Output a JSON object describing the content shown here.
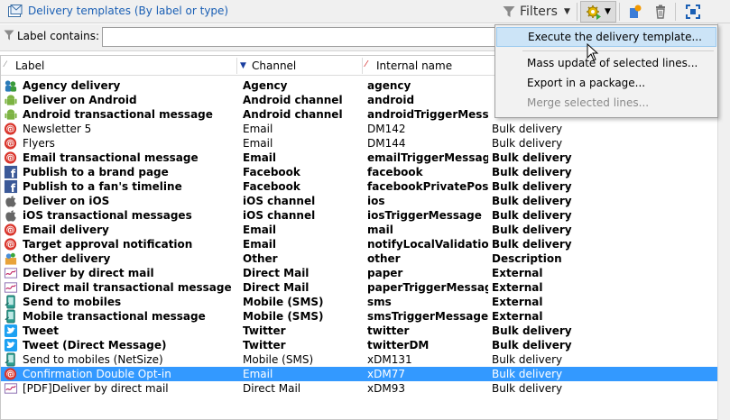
{
  "toolbar": {
    "title": "Delivery templates (By label or type)",
    "filters_label": "Filters"
  },
  "filter": {
    "label": "Label contains:",
    "value": ""
  },
  "columns": {
    "label": "Label",
    "channel": "Channel",
    "internal": "Internal name"
  },
  "menu": {
    "items": [
      {
        "label": "Execute the delivery template...",
        "state": "hover"
      },
      {
        "label": "Mass update of selected lines...",
        "state": "normal"
      },
      {
        "label": "Export in a package...",
        "state": "normal"
      },
      {
        "label": "Merge selected lines...",
        "state": "disabled"
      }
    ]
  },
  "colors": {
    "accent": "#1a5fb4",
    "selection": "#3399ff",
    "menu_hover": "#cce4f7"
  },
  "rows": [
    {
      "icon": "agency-icon",
      "label": "Agency delivery",
      "channel": "Agency",
      "internal": "agency",
      "type": "",
      "bold": true
    },
    {
      "icon": "android-icon",
      "label": "Deliver on Android",
      "channel": "Android channel",
      "internal": "android",
      "type": "",
      "bold": true
    },
    {
      "icon": "android-icon",
      "label": "Android transactional message",
      "channel": "Android channel",
      "internal": "androidTriggerMessage",
      "type": "",
      "bold": true
    },
    {
      "icon": "email-icon",
      "label": "Newsletter 5",
      "channel": "Email",
      "internal": "DM142",
      "type": "Bulk delivery",
      "bold": false
    },
    {
      "icon": "email-icon",
      "label": "Flyers",
      "channel": "Email",
      "internal": "DM144",
      "type": "Bulk delivery",
      "bold": false
    },
    {
      "icon": "email-icon",
      "label": "Email transactional message",
      "channel": "Email",
      "internal": "emailTriggerMessage",
      "type": "Bulk delivery",
      "bold": true
    },
    {
      "icon": "facebook-icon",
      "label": "Publish to a brand page",
      "channel": "Facebook",
      "internal": "facebook",
      "type": "Bulk delivery",
      "bold": true
    },
    {
      "icon": "facebook-icon",
      "label": "Publish to a fan's timeline",
      "channel": "Facebook",
      "internal": "facebookPrivatePost",
      "type": "Bulk delivery",
      "bold": true
    },
    {
      "icon": "apple-icon",
      "label": "Deliver on iOS",
      "channel": "iOS channel",
      "internal": "ios",
      "type": "Bulk delivery",
      "bold": true
    },
    {
      "icon": "apple-icon",
      "label": "iOS transactional messages",
      "channel": "iOS channel",
      "internal": "iosTriggerMessage",
      "type": "Bulk delivery",
      "bold": true
    },
    {
      "icon": "email-icon",
      "label": "Email delivery",
      "channel": "Email",
      "internal": "mail",
      "type": "Bulk delivery",
      "bold": true
    },
    {
      "icon": "email-icon",
      "label": "Target approval notification",
      "channel": "Email",
      "internal": "notifyLocalValidation",
      "type": "Bulk delivery",
      "bold": true
    },
    {
      "icon": "other-icon",
      "label": "Other delivery",
      "channel": "Other",
      "internal": "other",
      "type": "Description",
      "bold": true
    },
    {
      "icon": "direct-mail-icon",
      "label": "Deliver by direct mail",
      "channel": "Direct Mail",
      "internal": "paper",
      "type": "External",
      "bold": true
    },
    {
      "icon": "direct-mail-icon",
      "label": "Direct mail transactional message",
      "channel": "Direct Mail",
      "internal": "paperTriggerMessage",
      "type": "External",
      "bold": true
    },
    {
      "icon": "mobile-icon",
      "label": "Send to mobiles",
      "channel": "Mobile (SMS)",
      "internal": "sms",
      "type": "External",
      "bold": true
    },
    {
      "icon": "mobile-icon",
      "label": "Mobile transactional message",
      "channel": "Mobile (SMS)",
      "internal": "smsTriggerMessage",
      "type": "External",
      "bold": true
    },
    {
      "icon": "twitter-icon",
      "label": "Tweet",
      "channel": "Twitter",
      "internal": "twitter",
      "type": "Bulk delivery",
      "bold": true
    },
    {
      "icon": "twitter-icon",
      "label": "Tweet (Direct Message)",
      "channel": "Twitter",
      "internal": "twitterDM",
      "type": "Bulk delivery",
      "bold": true
    },
    {
      "icon": "mobile-icon",
      "label": "Send to mobiles (NetSize)",
      "channel": "Mobile (SMS)",
      "internal": "xDM131",
      "type": "Bulk delivery",
      "bold": false
    },
    {
      "icon": "email-icon",
      "label": "Confirmation Double Opt-in",
      "channel": "Email",
      "internal": "xDM77",
      "type": "Bulk delivery",
      "bold": false,
      "selected": true
    },
    {
      "icon": "direct-mail-icon",
      "label": "[PDF]Deliver by direct mail",
      "channel": "Direct Mail",
      "internal": "xDM93",
      "type": "Bulk delivery",
      "bold": false
    }
  ]
}
